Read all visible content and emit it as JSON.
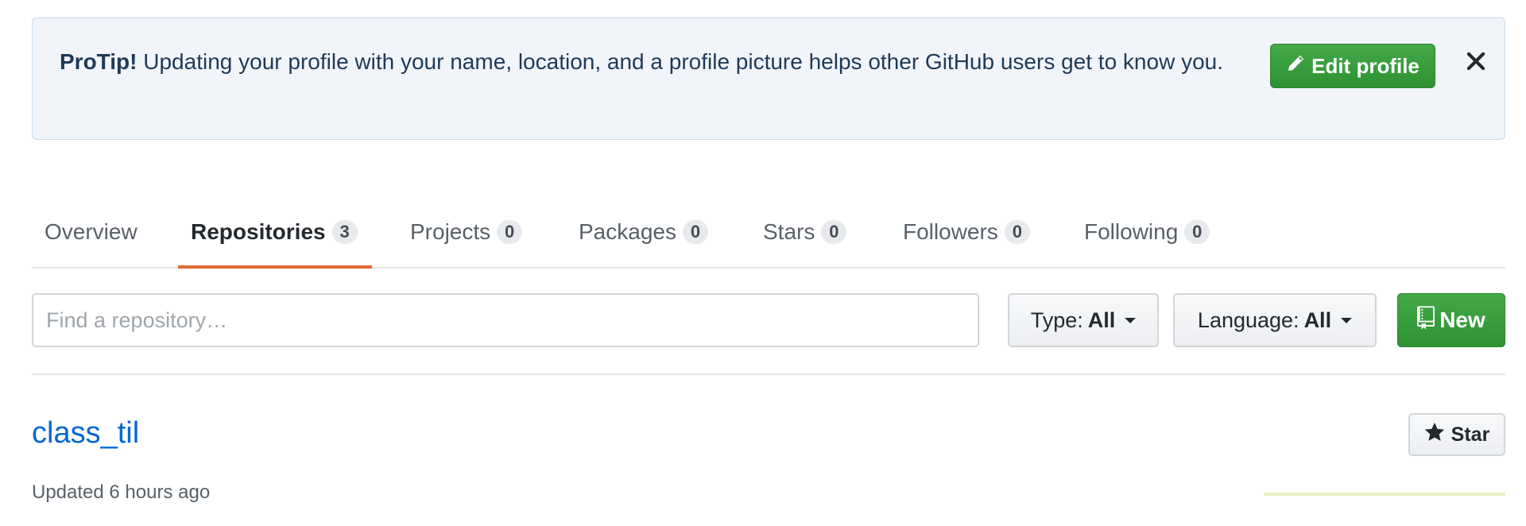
{
  "protip": {
    "lead": "ProTip!",
    "message": " Updating your profile with your name, location, and a profile picture helps other GitHub users get to know you.",
    "edit_button_label": "Edit profile",
    "edit_icon": "pencil-icon",
    "close_icon": "close-icon"
  },
  "tabs": [
    {
      "label": "Overview",
      "count": null,
      "selected": false
    },
    {
      "label": "Repositories",
      "count": "3",
      "selected": true
    },
    {
      "label": "Projects",
      "count": "0",
      "selected": false
    },
    {
      "label": "Packages",
      "count": "0",
      "selected": false
    },
    {
      "label": "Stars",
      "count": "0",
      "selected": false
    },
    {
      "label": "Followers",
      "count": "0",
      "selected": false
    },
    {
      "label": "Following",
      "count": "0",
      "selected": false
    }
  ],
  "filters": {
    "search_placeholder": "Find a repository…",
    "search_value": "",
    "type_label": "Type:",
    "type_value": "All",
    "language_label": "Language:",
    "language_value": "All",
    "new_label": "New",
    "new_icon": "repo-icon"
  },
  "repositories": [
    {
      "name": "class_til",
      "updated": "Updated 6 hours ago",
      "star_label": "Star",
      "star_icon": "star-icon"
    }
  ],
  "colors": {
    "accent_underline": "#e36a31",
    "primary_green": "#2e9234",
    "link_blue": "#0366d6",
    "banner_bg": "#f1f5fa"
  }
}
